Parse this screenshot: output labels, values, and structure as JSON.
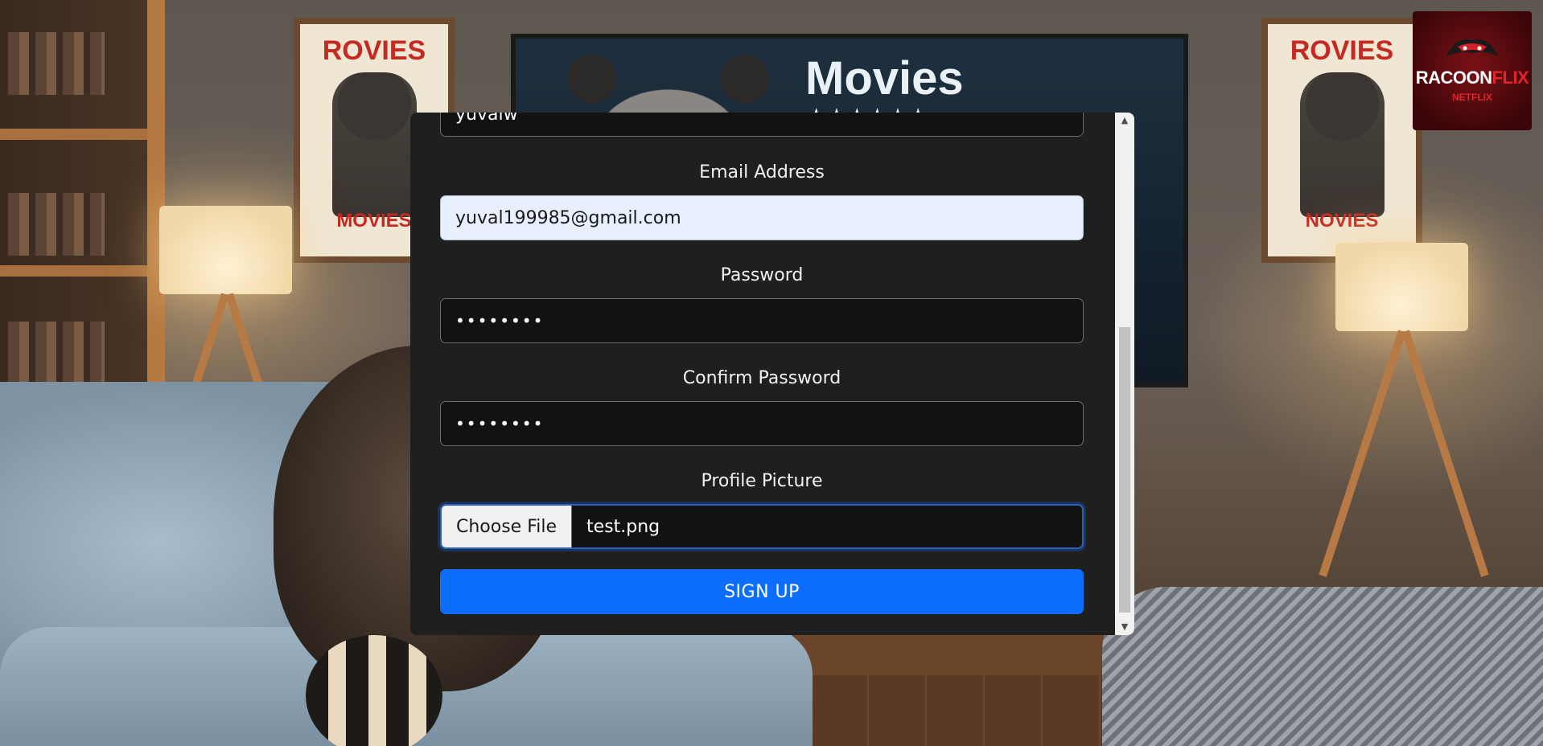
{
  "logo": {
    "brand_main": "RACOON",
    "brand_accent": "FLIX",
    "brand_sub": "NETFLIX"
  },
  "background": {
    "poster_left_title": "ROVIES",
    "poster_left_sub": "MOVIES",
    "poster_right_title": "ROVIES",
    "poster_right_sub": "NOVIES",
    "tv_title": "Movies",
    "tv_stars": "★★★★★★"
  },
  "form": {
    "username_value": "yuvalw",
    "email_label": "Email Address",
    "email_value": "yuval199985@gmail.com",
    "password_label": "Password",
    "password_value": "••••••••",
    "confirm_label": "Confirm Password",
    "confirm_value": "••••••••",
    "picture_label": "Profile Picture",
    "choose_file_label": "Choose File",
    "file_name": "test.png",
    "submit_label": "SIGN UP"
  },
  "scrollbar": {
    "up_arrow": "▲",
    "down_arrow": "▼"
  },
  "colors": {
    "panel_bg": "#1f1f1f",
    "input_bg": "#121212",
    "autofill_bg": "#e8f0fe",
    "primary_button": "#0d6efd",
    "brand_red": "#e0242c"
  }
}
